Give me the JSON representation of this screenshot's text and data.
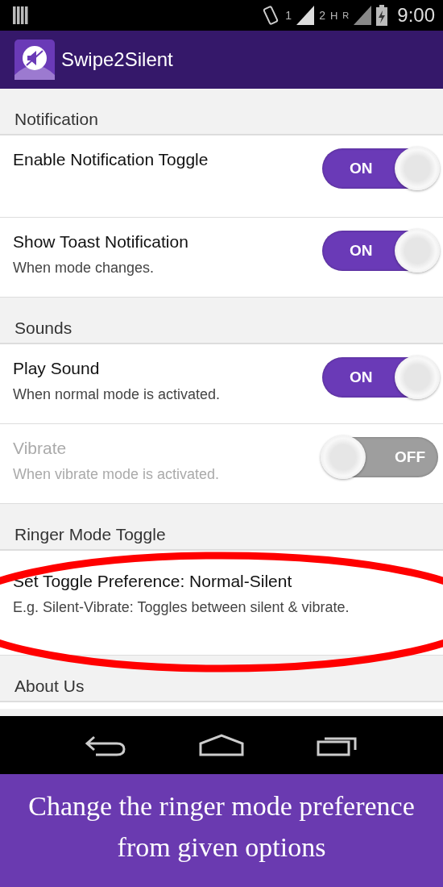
{
  "status_bar": {
    "sim_1": "1",
    "sim_2": "2",
    "network_1": "H",
    "network_2": "R",
    "time": "9:00"
  },
  "app_bar": {
    "title": "Swipe2Silent"
  },
  "sections": [
    {
      "title": "Notification",
      "rows": [
        {
          "kind": "switch",
          "title": "Enable Notification Toggle",
          "on": true,
          "disabled": false,
          "switch_label": "ON"
        },
        {
          "kind": "switch",
          "title": "Show Toast Notification",
          "summary": "When mode changes.",
          "on": true,
          "disabled": false,
          "switch_label": "ON"
        }
      ]
    },
    {
      "title": "Sounds",
      "rows": [
        {
          "kind": "switch",
          "title": "Play Sound",
          "summary": "When normal mode is activated.",
          "on": true,
          "disabled": false,
          "switch_label": "ON"
        },
        {
          "kind": "switch",
          "title": "Vibrate",
          "summary": "When vibrate mode is activated.",
          "on": false,
          "disabled": true,
          "switch_label": "OFF"
        }
      ]
    },
    {
      "title": "Ringer Mode Toggle",
      "rows": [
        {
          "kind": "text",
          "title": "Set Toggle Preference:  Normal-Silent",
          "summary": "E.g. Silent-Vibrate: Toggles between silent & vibrate."
        }
      ]
    },
    {
      "title": "About Us"
    }
  ],
  "caption": "Change the ringer mode preference from given options"
}
